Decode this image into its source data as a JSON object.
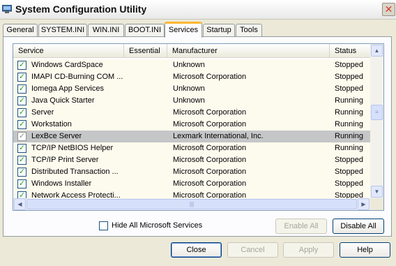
{
  "window": {
    "title": "System Configuration Utility",
    "close_glyph": "✕"
  },
  "tabs": [
    {
      "label": "General"
    },
    {
      "label": "SYSTEM.INI"
    },
    {
      "label": "WIN.INI"
    },
    {
      "label": "BOOT.INI"
    },
    {
      "label": "Services",
      "active": true
    },
    {
      "label": "Startup"
    },
    {
      "label": "Tools"
    }
  ],
  "services": {
    "columns": [
      "Service",
      "Essential",
      "Manufacturer",
      "Status"
    ],
    "check_glyph": "✓",
    "rows": [
      {
        "service": "Windows CardSpace",
        "essential": "",
        "manufacturer": "Unknown",
        "status": "Stopped",
        "checked": true
      },
      {
        "service": "IMAPI CD-Burning COM ...",
        "essential": "",
        "manufacturer": "Microsoft Corporation",
        "status": "Stopped",
        "checked": true
      },
      {
        "service": "Iomega App Services",
        "essential": "",
        "manufacturer": "Unknown",
        "status": "Stopped",
        "checked": true
      },
      {
        "service": "Java Quick Starter",
        "essential": "",
        "manufacturer": "Unknown",
        "status": "Running",
        "checked": true
      },
      {
        "service": "Server",
        "essential": "",
        "manufacturer": "Microsoft Corporation",
        "status": "Running",
        "checked": true
      },
      {
        "service": "Workstation",
        "essential": "",
        "manufacturer": "Microsoft Corporation",
        "status": "Running",
        "checked": true
      },
      {
        "service": "LexBce Server",
        "essential": "",
        "manufacturer": "Lexmark International, Inc.",
        "status": "Running",
        "checked": true,
        "selected": true
      },
      {
        "service": "TCP/IP NetBIOS Helper",
        "essential": "",
        "manufacturer": "Microsoft Corporation",
        "status": "Running",
        "checked": true
      },
      {
        "service": "TCP/IP Print Server",
        "essential": "",
        "manufacturer": "Microsoft Corporation",
        "status": "Stopped",
        "checked": true
      },
      {
        "service": "Distributed Transaction ...",
        "essential": "",
        "manufacturer": "Microsoft Corporation",
        "status": "Stopped",
        "checked": true
      },
      {
        "service": "Windows Installer",
        "essential": "",
        "manufacturer": "Microsoft Corporation",
        "status": "Stopped",
        "checked": true
      },
      {
        "service": "Network Access Protecti...",
        "essential": "",
        "manufacturer": "Microsoft Corporation",
        "status": "Stopped",
        "checked": true
      }
    ],
    "scroll_up_glyph": "▲",
    "scroll_down_glyph": "▼",
    "scroll_left_glyph": "◀",
    "scroll_right_glyph": "▶",
    "grip_glyph": "≡",
    "hgrip_glyph": "|||"
  },
  "options": {
    "hide_ms_label": "Hide All Microsoft Services"
  },
  "buttons": {
    "enable_all": "Enable All",
    "disable_all": "Disable All",
    "close": "Close",
    "cancel": "Cancel",
    "apply": "Apply",
    "help": "Help"
  }
}
